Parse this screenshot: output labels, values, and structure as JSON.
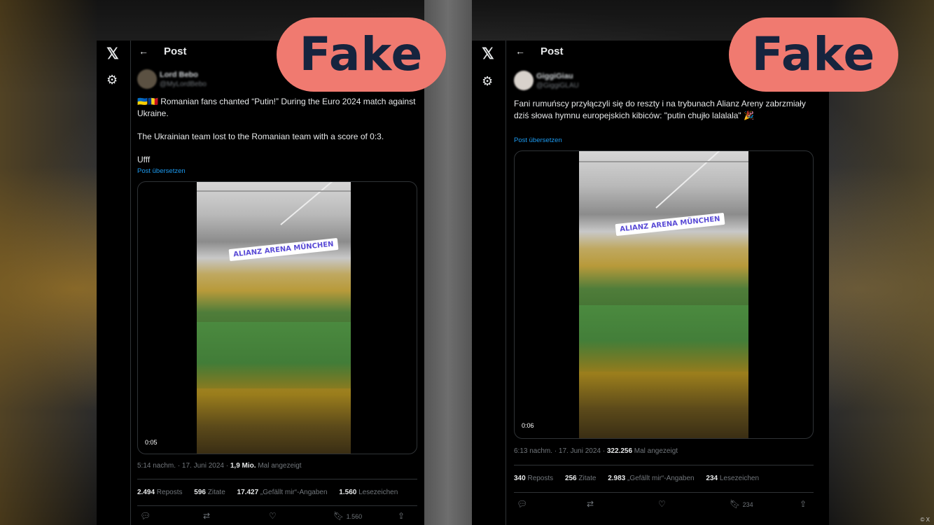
{
  "colors": {
    "fake_badge": "#f07a70",
    "fake_text": "#16243e",
    "link_blue": "#1d9bf0"
  },
  "icons": {
    "logo": "x-logo-icon",
    "settings": "gear-icon",
    "back": "arrow-left-icon"
  },
  "badge_label": "Fake",
  "credit": "© X",
  "left_post": {
    "header_title": "Post",
    "user_name": "Lord Bebo",
    "user_handle": "@MyLordBebo",
    "flags": "🇺🇦🇷🇴",
    "text_1": " Romanian fans chanted “Putin!” During the Euro 2024 match against Ukraine.",
    "text_2": "The Ukrainian team lost to the Romanian team with a score of 0:3.",
    "text_3": "Ufff",
    "translate": "Post übersetzen",
    "sticker": "ALIANZ ARENA MÜNCHEN",
    "duration": "0:05",
    "time": "5:14 nachm. · 17. Juni 2024 · ",
    "views": "1,9 Mio.",
    "views_label": " Mal angezeigt",
    "reposts": "2.494",
    "reposts_label": " Reposts",
    "quotes": "596",
    "quotes_label": " Zitate",
    "likes": "17.427",
    "likes_label": " „Gefällt mir“-Angaben",
    "bookmarks": "1.560",
    "bookmarks_label": " Lesezeichen",
    "bookmark_count": "1.560"
  },
  "right_post": {
    "header_title": "Post",
    "user_name": "GiggiGiau",
    "user_handle": "@GiggiGLAU",
    "text_1": "Fani rumuńscy przyłączyli się do reszty i na trybunach Alianz Areny zabrzmiały dziś słowa hymnu europejskich kibiców: \"putin chujło lalalala\" 🎉",
    "translate": "Post übersetzen",
    "sticker": "ALIANZ ARENA MÜNCHEN",
    "duration": "0:06",
    "time": "6:13 nachm. · 17. Juni 2024 · ",
    "views": "322.256",
    "views_label": " Mal angezeigt",
    "reposts": "340",
    "reposts_label": " Reposts",
    "quotes": "256",
    "quotes_label": " Zitate",
    "likes": "2.983",
    "likes_label": " „Gefällt mir“-Angaben",
    "bookmarks": "234",
    "bookmarks_label": " Lesezeichen",
    "bookmark_count": "234"
  }
}
